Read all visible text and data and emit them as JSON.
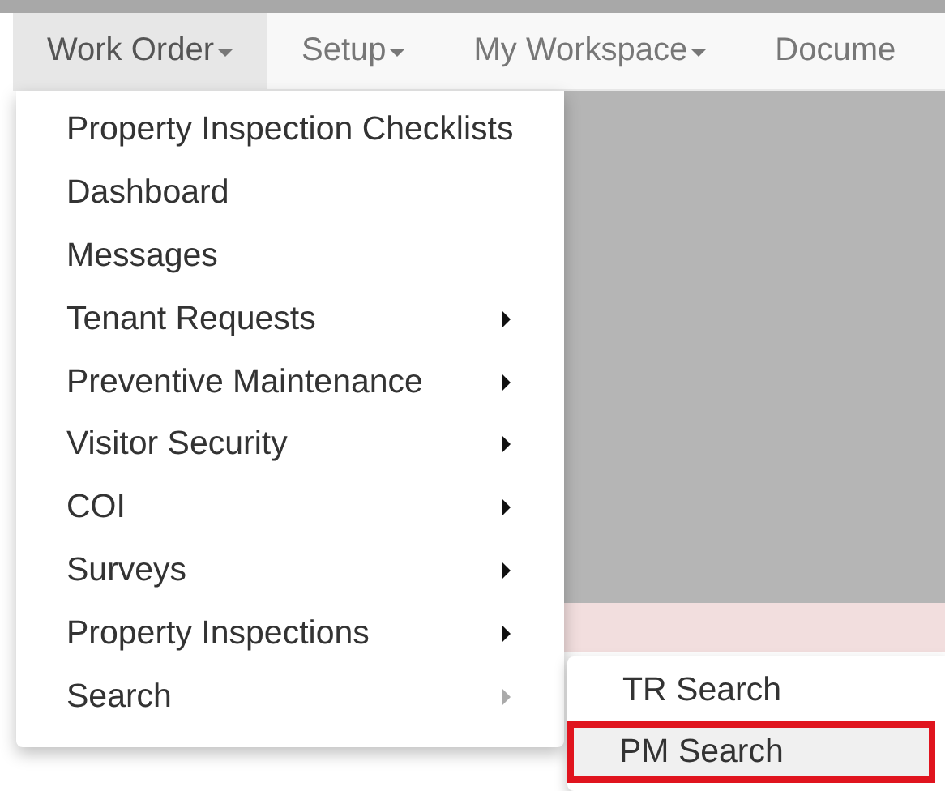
{
  "navbar": [
    {
      "label": "Work Order",
      "selected": true,
      "caret": true
    },
    {
      "label": "Setup",
      "selected": false,
      "caret": true
    },
    {
      "label": "My Workspace",
      "selected": false,
      "caret": true
    },
    {
      "label": "Docume",
      "selected": false,
      "caret": false
    }
  ],
  "menu": [
    {
      "label": "Property Inspection Checklists",
      "kind": "plain"
    },
    {
      "label": "Dashboard",
      "kind": "plain"
    },
    {
      "label": "Messages",
      "kind": "plain"
    },
    {
      "label": "Tenant Requests",
      "kind": "submenu",
      "expanded": false
    },
    {
      "label": "Preventive Maintenance",
      "kind": "submenu",
      "expanded": false
    },
    {
      "label": "Visitor Security",
      "kind": "submenu",
      "expanded": false
    },
    {
      "label": "COI",
      "kind": "submenu",
      "expanded": false
    },
    {
      "label": "Surveys",
      "kind": "submenu",
      "expanded": false
    },
    {
      "label": "Property Inspections",
      "kind": "submenu",
      "expanded": false
    },
    {
      "label": "Search",
      "kind": "submenu",
      "expanded": true
    }
  ],
  "submenu": [
    {
      "label": "TR Search",
      "selected": false,
      "highlighted": false
    },
    {
      "label": "PM Search",
      "selected": true,
      "highlighted": true
    }
  ]
}
